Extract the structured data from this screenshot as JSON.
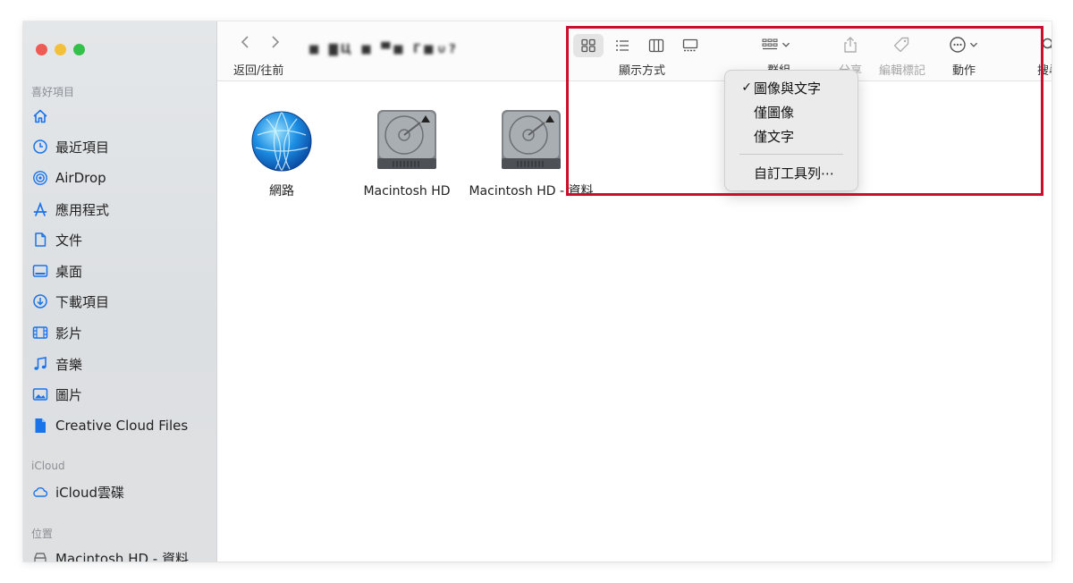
{
  "window": {
    "title_blurred": "■ ▇Ц ■ ▀■ Γ■∪?"
  },
  "sidebar": {
    "sections": [
      {
        "title": "喜好項目",
        "items": [
          {
            "label": "",
            "icon": "home-icon"
          },
          {
            "label": "最近項目",
            "icon": "clock-icon"
          },
          {
            "label": "AirDrop",
            "icon": "airdrop-icon"
          },
          {
            "label": "應用程式",
            "icon": "applications-icon"
          },
          {
            "label": "文件",
            "icon": "document-icon"
          },
          {
            "label": "桌面",
            "icon": "desktop-icon"
          },
          {
            "label": "下載項目",
            "icon": "download-icon"
          },
          {
            "label": "影片",
            "icon": "film-icon"
          },
          {
            "label": "音樂",
            "icon": "music-icon"
          },
          {
            "label": "圖片",
            "icon": "photo-icon"
          },
          {
            "label": "Creative Cloud Files",
            "icon": "file-icon"
          }
        ]
      },
      {
        "title": "iCloud",
        "items": [
          {
            "label": "iCloud雲碟",
            "icon": "cloud-icon"
          }
        ]
      },
      {
        "title": "位置",
        "items": [
          {
            "label": "Macintosh HD - 資料",
            "icon": "disk-icon"
          }
        ]
      }
    ]
  },
  "toolbar": {
    "nav_label": "返回/往前",
    "view_label": "顯示方式",
    "group_label": "群組",
    "share_label": "分享",
    "tags_label": "編輯標記",
    "action_label": "動作",
    "search_label": "搜尋"
  },
  "files": [
    {
      "name": "網路",
      "icon": "network-globe-icon"
    },
    {
      "name": "Macintosh HD",
      "icon": "hard-drive-icon"
    },
    {
      "name": "Macintosh HD - 資料",
      "icon": "hard-drive-icon"
    }
  ],
  "context_menu": {
    "items": [
      {
        "label": "圖像與文字",
        "checked": true,
        "check": "✓"
      },
      {
        "label": "僅圖像",
        "checked": false,
        "check": ""
      },
      {
        "label": "僅文字",
        "checked": false,
        "check": ""
      },
      {
        "label": "自訂工具列⋯",
        "checked": false,
        "check": ""
      }
    ]
  },
  "colors": {
    "highlight": "#c8102e",
    "accent": "#1a73e8"
  }
}
